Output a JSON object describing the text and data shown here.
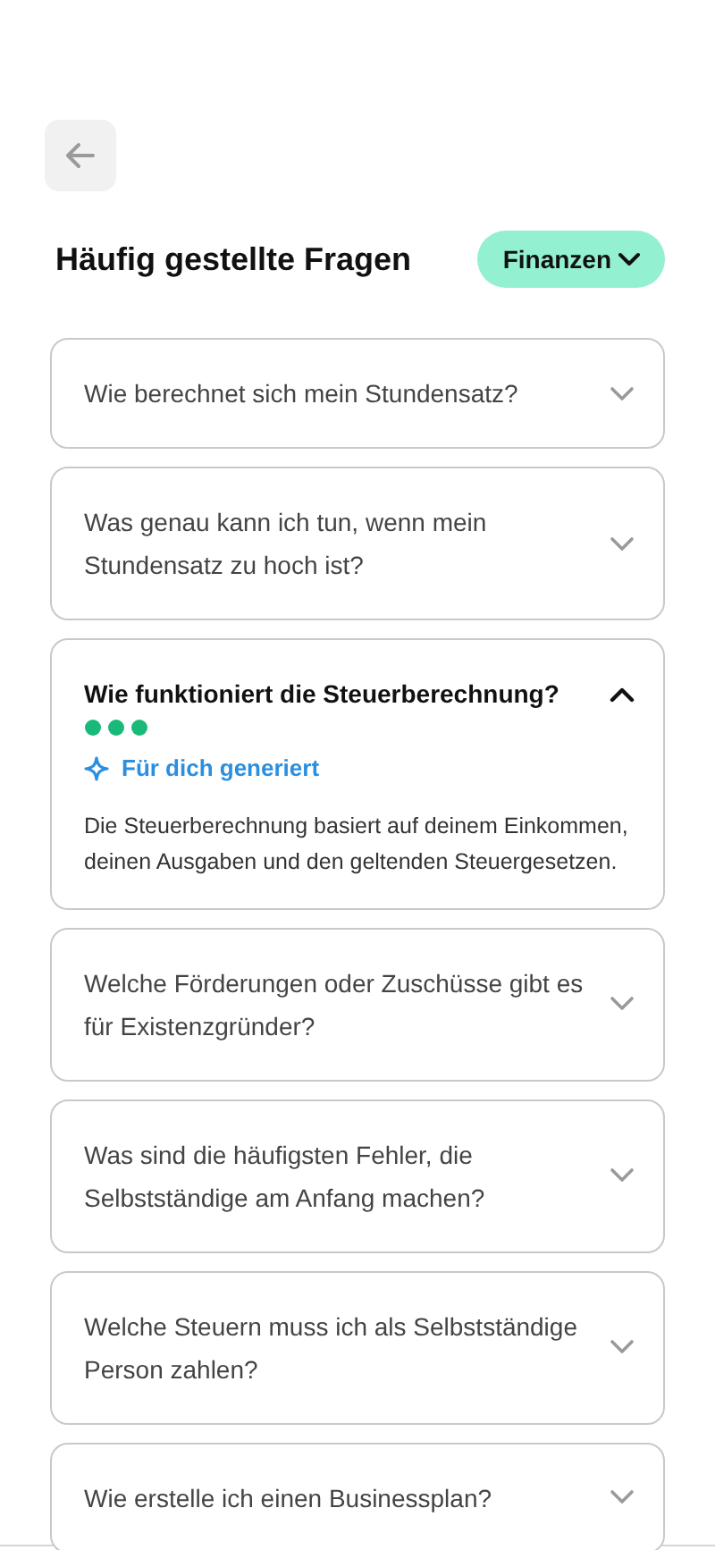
{
  "header": {
    "title": "Häufig gestellte Fragen",
    "category": "Finanzen"
  },
  "faqs": [
    {
      "question": "Wie berechnet sich mein Stundensatz?",
      "expanded": false
    },
    {
      "question": "Was genau kann ich tun, wenn mein Stundensatz zu hoch ist?",
      "expanded": false
    },
    {
      "question": "Wie funktioniert die Steuerberechnung?",
      "expanded": true,
      "badge": "Für dich generiert",
      "answer": "Die Steuerberechnung basiert auf deinem Einkommen, deinen Ausgaben und den geltenden Steuergesetzen."
    },
    {
      "question": "Welche Förderungen oder Zuschüsse gibt es für Existenzgründer?",
      "expanded": false
    },
    {
      "question": "Was sind die häufigsten Fehler, die Selbstständige am Anfang machen?",
      "expanded": false
    },
    {
      "question": "Welche Steuern muss ich als Selbstständige Person zahlen?",
      "expanded": false
    },
    {
      "question": "Wie erstelle ich einen Businessplan?",
      "expanded": false
    }
  ]
}
